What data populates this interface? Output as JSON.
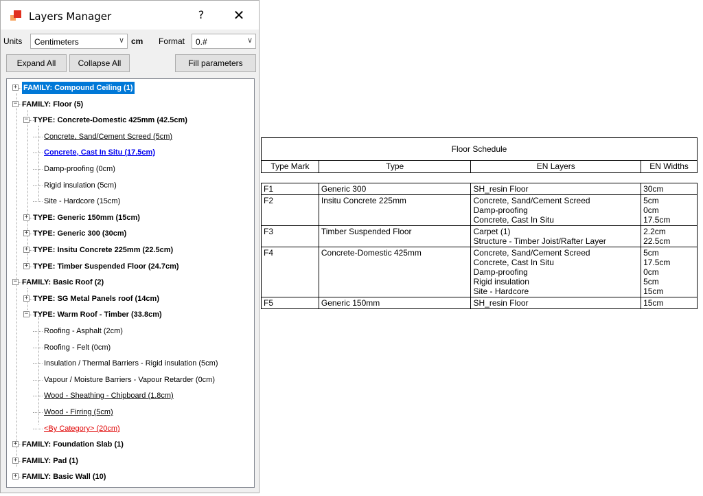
{
  "window": {
    "title": "Layers Manager",
    "help_label": "?",
    "close_label": "✕"
  },
  "units": {
    "label": "Units",
    "selected": "Centimeters",
    "suffix": "cm",
    "format_label": "Format",
    "format_selected": "0.#"
  },
  "buttons": {
    "expand_all": "Expand All",
    "collapse_all": "Collapse All",
    "fill_parameters": "Fill parameters"
  },
  "tree": {
    "nodes": [
      {
        "text": "FAMILY: Compound Ceiling (1)",
        "level": 0,
        "expander": "+",
        "style": "selected"
      },
      {
        "text": "FAMILY: Floor (5)",
        "level": 0,
        "expander": "-",
        "style": "bold"
      },
      {
        "text": "TYPE: Concrete-Domestic 425mm (42.5cm)",
        "level": 1,
        "expander": "-",
        "style": "bold"
      },
      {
        "text": "Concrete, Sand/Cement Screed (5cm)",
        "level": 2,
        "expander": "",
        "style": "ul"
      },
      {
        "text": "Concrete, Cast In Situ (17.5cm)",
        "level": 2,
        "expander": "",
        "style": "link"
      },
      {
        "text": "Damp-proofing (0cm)",
        "level": 2,
        "expander": "",
        "style": "plain"
      },
      {
        "text": "Rigid insulation (5cm)",
        "level": 2,
        "expander": "",
        "style": "plain"
      },
      {
        "text": "Site - Hardcore (15cm)",
        "level": 2,
        "expander": "",
        "style": "plain"
      },
      {
        "text": "TYPE: Generic 150mm (15cm)",
        "level": 1,
        "expander": "+",
        "style": "bold"
      },
      {
        "text": "TYPE: Generic 300 (30cm)",
        "level": 1,
        "expander": "+",
        "style": "bold"
      },
      {
        "text": "TYPE: Insitu Concrete 225mm (22.5cm)",
        "level": 1,
        "expander": "+",
        "style": "bold"
      },
      {
        "text": "TYPE: Timber Suspended Floor (24.7cm)",
        "level": 1,
        "expander": "+",
        "style": "bold"
      },
      {
        "text": "FAMILY: Basic Roof (2)",
        "level": 0,
        "expander": "-",
        "style": "bold"
      },
      {
        "text": "TYPE: SG Metal Panels roof (14cm)",
        "level": 1,
        "expander": "+",
        "style": "bold"
      },
      {
        "text": "TYPE: Warm Roof - Timber (33.8cm)",
        "level": 1,
        "expander": "-",
        "style": "bold"
      },
      {
        "text": "Roofing - Asphalt (2cm)",
        "level": 2,
        "expander": "",
        "style": "plain"
      },
      {
        "text": "Roofing - Felt (0cm)",
        "level": 2,
        "expander": "",
        "style": "plain"
      },
      {
        "text": "Insulation / Thermal Barriers - Rigid insulation (5cm)",
        "level": 2,
        "expander": "",
        "style": "plain"
      },
      {
        "text": "Vapour / Moisture Barriers - Vapour Retarder (0cm)",
        "level": 2,
        "expander": "",
        "style": "plain"
      },
      {
        "text": "Wood - Sheathing - Chipboard (1.8cm)",
        "level": 2,
        "expander": "",
        "style": "ul"
      },
      {
        "text": "Wood - Firring (5cm)",
        "level": 2,
        "expander": "",
        "style": "ul"
      },
      {
        "text": "<By Category> (20cm)",
        "level": 2,
        "expander": "",
        "style": "red"
      },
      {
        "text": "FAMILY: Foundation Slab (1)",
        "level": 0,
        "expander": "+",
        "style": "bold"
      },
      {
        "text": "FAMILY: Pad (1)",
        "level": 0,
        "expander": "+",
        "style": "bold"
      },
      {
        "text": "FAMILY: Basic Wall (10)",
        "level": 0,
        "expander": "+",
        "style": "bold"
      }
    ]
  },
  "schedule": {
    "title": "Floor Schedule",
    "headers": [
      "Type Mark",
      "Type",
      "EN Layers",
      "EN Widths"
    ],
    "rows": [
      {
        "mark": "F1",
        "type": "Generic 300",
        "layers": [
          "SH_resin Floor"
        ],
        "widths": [
          "30cm"
        ]
      },
      {
        "mark": "F2",
        "type": "Insitu Concrete 225mm",
        "layers": [
          "Concrete, Sand/Cement Screed",
          "Damp-proofing",
          "Concrete, Cast In Situ"
        ],
        "widths": [
          "5cm",
          "0cm",
          "17.5cm"
        ]
      },
      {
        "mark": "F3",
        "type": "Timber Suspended Floor",
        "layers": [
          "Carpet (1)",
          "Structure - Timber Joist/Rafter Layer"
        ],
        "widths": [
          "2.2cm",
          "22.5cm"
        ]
      },
      {
        "mark": "F4",
        "type": "Concrete-Domestic 425mm",
        "layers": [
          "Concrete, Sand/Cement Screed",
          "Concrete, Cast In Situ",
          "Damp-proofing",
          "Rigid insulation",
          "Site - Hardcore"
        ],
        "widths": [
          "5cm",
          "17.5cm",
          "0cm",
          "5cm",
          "15cm"
        ]
      },
      {
        "mark": "F5",
        "type": "Generic 150mm",
        "layers": [
          "SH_resin Floor"
        ],
        "widths": [
          "15cm"
        ]
      }
    ]
  }
}
